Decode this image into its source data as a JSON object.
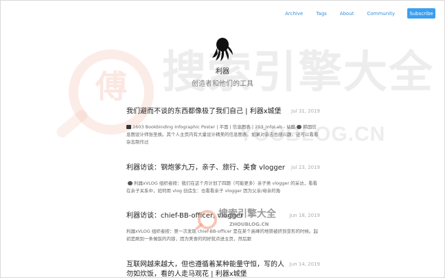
{
  "nav": {
    "links": [
      "Archive",
      "Tags",
      "About",
      "Community"
    ],
    "subscribe": "Subscribe"
  },
  "header": {
    "title": "利器",
    "subtitle": "创造者和他们的工具"
  },
  "watermarks": {
    "logo_char": "傅",
    "big": "搜索引擎大全",
    "url": "YOUBLOG.CN",
    "small_title": "搜索引擎大全",
    "small_url": "ZHOUBLOG.CN"
  },
  "posts": [
    {
      "title": "我们避而不谈的东西都像极了我们自己 | 利器x城堡",
      "date": "Jul 31, 2019",
      "excerpt_a": "1603 Bookbinding Infographic Poster | 平面 | 信息图表 | 203_InfoLab - 站酷",
      "excerpt_b": "韩国信息图设计师张圣焕。其个人主页内有大量设计精美的信息图表。如果对杂志也感兴趣，还可以看看 杂志制作过"
    },
    {
      "title": "利器访谈：钢炮爹九万，亲子、旅行、美食 vlogger",
      "date": "Jul 23, 2019",
      "excerpt": "利器xVLOG 组织者按：我们在这个月计划了四期（可能更多）亲子类 vlogger 的采访，看看在亲子关系中，如何用 vlog 创造生：也看看亲子 vlogger 因为父亲/母亲的角"
    },
    {
      "title": "利器访谈：chief-BB-officer, vlogger",
      "date": "Jun 18, 2019",
      "excerpt": "利器xVLOG 组织者按：第一次发现 chief-BB-officer 是在某个高峰的地铁被挤到变形的时候。起初是刷到一条做饭的内容，因为美食的同好就点进主页，然后跟"
    },
    {
      "title": "互联网越来越大，但也遵循着某种能量守恒，写的人",
      "title_2": "勿如炊饭，看的人走马观花 | 利器x城堡",
      "date": "Jun 14, 2019"
    }
  ]
}
